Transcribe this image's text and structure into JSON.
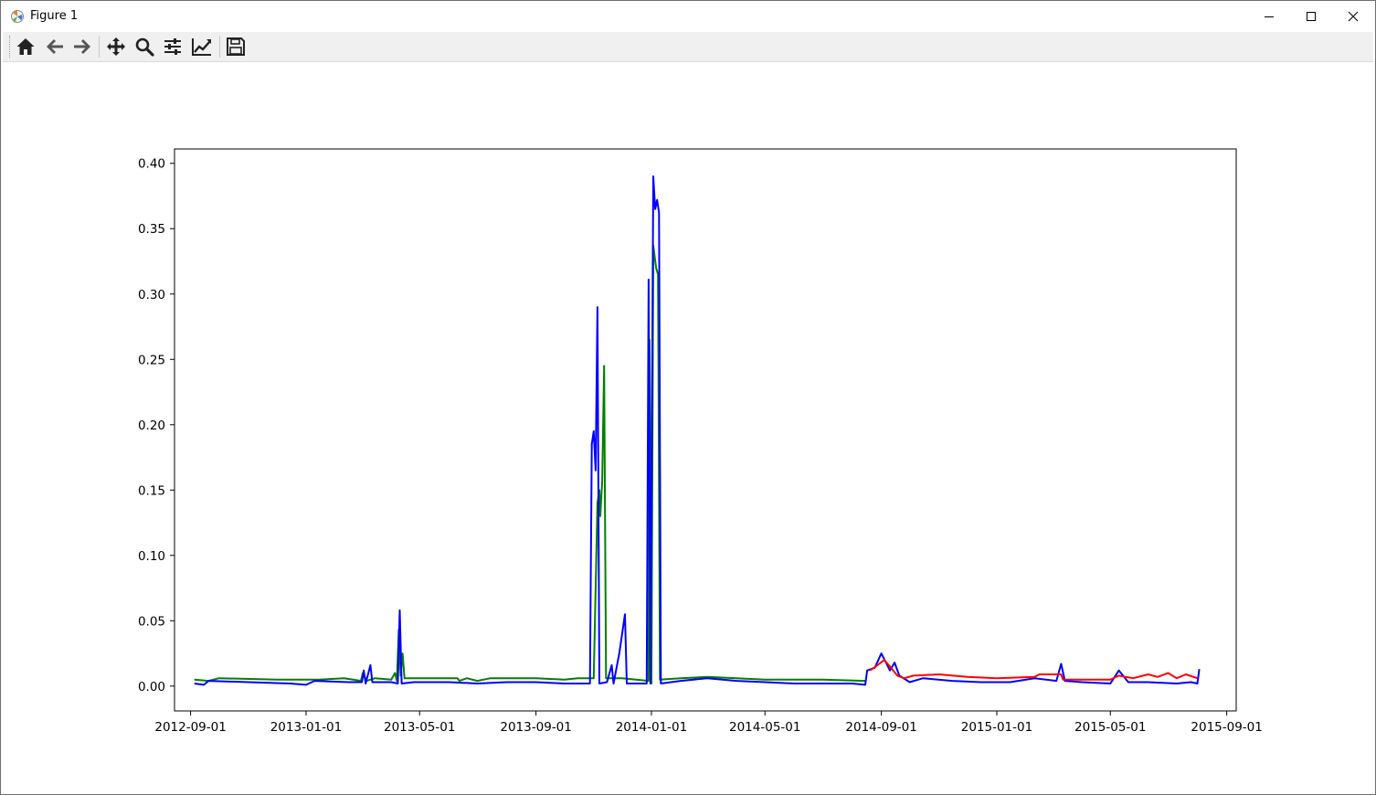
{
  "window": {
    "title": "Figure 1",
    "icon": "matplotlib-icon",
    "controls": [
      "minimize-icon",
      "maximize-icon",
      "close-icon"
    ]
  },
  "toolbar": {
    "buttons": [
      "home-icon",
      "back-icon",
      "forward-icon",
      "pan-icon",
      "zoom-icon",
      "configure-subplots-icon",
      "edit-axis-icon",
      "save-icon"
    ]
  },
  "chart_data": {
    "type": "line",
    "title": "",
    "xlabel": "",
    "ylabel": "",
    "xlim": [
      "2012-08-15",
      "2015-09-11"
    ],
    "ylim": [
      -0.019,
      0.411
    ],
    "xticks": [
      "2012-09-01",
      "2013-01-01",
      "2013-05-01",
      "2013-09-01",
      "2014-01-01",
      "2014-05-01",
      "2014-09-01",
      "2015-01-01",
      "2015-05-01",
      "2015-09-01"
    ],
    "yticks": [
      "0.00",
      "0.05",
      "0.10",
      "0.15",
      "0.20",
      "0.25",
      "0.30",
      "0.35",
      "0.40"
    ],
    "grid": false,
    "legend": "none",
    "series": [
      {
        "color": "#008000",
        "points": [
          [
            "2012-09-05",
            0.005
          ],
          [
            "2012-09-20",
            0.004
          ],
          [
            "2012-10-01",
            0.006
          ],
          [
            "2012-12-01",
            0.005
          ],
          [
            "2013-01-15",
            0.005
          ],
          [
            "2013-02-10",
            0.006
          ],
          [
            "2013-02-28",
            0.004
          ],
          [
            "2013-03-02",
            0.01
          ],
          [
            "2013-03-06",
            0.004
          ],
          [
            "2013-03-15",
            0.006
          ],
          [
            "2013-04-01",
            0.005
          ],
          [
            "2013-04-05",
            0.01
          ],
          [
            "2013-04-07",
            0.004
          ],
          [
            "2013-04-09",
            0.043
          ],
          [
            "2013-04-11",
            0.008
          ],
          [
            "2013-04-13",
            0.025
          ],
          [
            "2013-04-15",
            0.006
          ],
          [
            "2013-05-10",
            0.006
          ],
          [
            "2013-06-10",
            0.006
          ],
          [
            "2013-06-12",
            0.004
          ],
          [
            "2013-06-20",
            0.006
          ],
          [
            "2013-07-01",
            0.004
          ],
          [
            "2013-07-15",
            0.006
          ],
          [
            "2013-09-01",
            0.006
          ],
          [
            "2013-10-01",
            0.005
          ],
          [
            "2013-10-15",
            0.006
          ],
          [
            "2013-11-01",
            0.006
          ],
          [
            "2013-11-05",
            0.14
          ],
          [
            "2013-11-07",
            0.15
          ],
          [
            "2013-11-08",
            0.13
          ],
          [
            "2013-11-10",
            0.157
          ],
          [
            "2013-11-12",
            0.245
          ],
          [
            "2013-11-14",
            0.006
          ],
          [
            "2013-12-01",
            0.006
          ],
          [
            "2013-12-29",
            0.004
          ],
          [
            "2013-12-30",
            0.265
          ],
          [
            "2014-01-01",
            0.002
          ],
          [
            "2014-01-03",
            0.337
          ],
          [
            "2014-01-06",
            0.32
          ],
          [
            "2014-01-08",
            0.315
          ],
          [
            "2014-01-10",
            0.005
          ],
          [
            "2014-02-01",
            0.006
          ],
          [
            "2014-03-01",
            0.007
          ],
          [
            "2014-04-01",
            0.006
          ],
          [
            "2014-05-01",
            0.005
          ],
          [
            "2014-06-01",
            0.005
          ],
          [
            "2014-07-01",
            0.005
          ],
          [
            "2014-08-15",
            0.004
          ]
        ]
      },
      {
        "color": "#0000ff",
        "points": [
          [
            "2012-09-05",
            0.002
          ],
          [
            "2012-09-15",
            0.001
          ],
          [
            "2012-09-20",
            0.004
          ],
          [
            "2012-11-01",
            0.003
          ],
          [
            "2012-12-15",
            0.002
          ],
          [
            "2013-01-01",
            0.001
          ],
          [
            "2013-01-10",
            0.004
          ],
          [
            "2013-02-15",
            0.003
          ],
          [
            "2013-03-01",
            0.003
          ],
          [
            "2013-03-03",
            0.012
          ],
          [
            "2013-03-05",
            0.002
          ],
          [
            "2013-03-10",
            0.016
          ],
          [
            "2013-03-12",
            0.003
          ],
          [
            "2013-04-01",
            0.003
          ],
          [
            "2013-04-08",
            0.002
          ],
          [
            "2013-04-10",
            0.058
          ],
          [
            "2013-04-12",
            0.002
          ],
          [
            "2013-04-25",
            0.003
          ],
          [
            "2013-06-01",
            0.003
          ],
          [
            "2013-07-01",
            0.002
          ],
          [
            "2013-08-01",
            0.003
          ],
          [
            "2013-09-01",
            0.003
          ],
          [
            "2013-10-01",
            0.002
          ],
          [
            "2013-10-20",
            0.002
          ],
          [
            "2013-10-28",
            0.002
          ],
          [
            "2013-10-30",
            0.185
          ],
          [
            "2013-11-01",
            0.195
          ],
          [
            "2013-11-03",
            0.165
          ],
          [
            "2013-11-05",
            0.29
          ],
          [
            "2013-11-07",
            0.002
          ],
          [
            "2013-11-15",
            0.003
          ],
          [
            "2013-11-20",
            0.016
          ],
          [
            "2013-11-22",
            0.002
          ],
          [
            "2013-11-28",
            0.025
          ],
          [
            "2013-12-04",
            0.055
          ],
          [
            "2013-12-06",
            0.002
          ],
          [
            "2013-12-27",
            0.002
          ],
          [
            "2013-12-29",
            0.311
          ],
          [
            "2013-12-31",
            0.002
          ],
          [
            "2014-01-03",
            0.39
          ],
          [
            "2014-01-05",
            0.365
          ],
          [
            "2014-01-07",
            0.372
          ],
          [
            "2014-01-09",
            0.362
          ],
          [
            "2014-01-11",
            0.002
          ],
          [
            "2014-02-01",
            0.004
          ],
          [
            "2014-03-01",
            0.006
          ],
          [
            "2014-04-01",
            0.004
          ],
          [
            "2014-05-01",
            0.003
          ],
          [
            "2014-06-01",
            0.002
          ],
          [
            "2014-08-01",
            0.002
          ],
          [
            "2014-08-15",
            0.001
          ],
          [
            "2014-08-17",
            0.012
          ],
          [
            "2014-08-25",
            0.014
          ],
          [
            "2014-09-01",
            0.025
          ],
          [
            "2014-09-10",
            0.012
          ],
          [
            "2014-09-15",
            0.018
          ],
          [
            "2014-09-20",
            0.008
          ],
          [
            "2014-10-01",
            0.003
          ],
          [
            "2014-10-15",
            0.006
          ],
          [
            "2014-11-15",
            0.004
          ],
          [
            "2014-12-15",
            0.003
          ],
          [
            "2015-01-15",
            0.003
          ],
          [
            "2015-02-10",
            0.006
          ],
          [
            "2015-03-05",
            0.004
          ],
          [
            "2015-03-10",
            0.017
          ],
          [
            "2015-03-14",
            0.004
          ],
          [
            "2015-04-01",
            0.003
          ],
          [
            "2015-05-01",
            0.002
          ],
          [
            "2015-05-10",
            0.012
          ],
          [
            "2015-05-20",
            0.003
          ],
          [
            "2015-06-10",
            0.003
          ],
          [
            "2015-07-10",
            0.002
          ],
          [
            "2015-07-25",
            0.003
          ],
          [
            "2015-08-01",
            0.002
          ],
          [
            "2015-08-03",
            0.013
          ]
        ]
      },
      {
        "color": "#ff0000",
        "points": [
          [
            "2014-08-20",
            0.012
          ],
          [
            "2014-08-28",
            0.016
          ],
          [
            "2014-09-04",
            0.02
          ],
          [
            "2014-09-10",
            0.015
          ],
          [
            "2014-09-18",
            0.008
          ],
          [
            "2014-09-25",
            0.006
          ],
          [
            "2014-10-05",
            0.008
          ],
          [
            "2014-11-01",
            0.009
          ],
          [
            "2014-12-01",
            0.007
          ],
          [
            "2015-01-01",
            0.006
          ],
          [
            "2015-02-10",
            0.007
          ],
          [
            "2015-02-15",
            0.009
          ],
          [
            "2015-03-10",
            0.009
          ],
          [
            "2015-03-12",
            0.005
          ],
          [
            "2015-05-01",
            0.005
          ],
          [
            "2015-05-10",
            0.008
          ],
          [
            "2015-05-25",
            0.006
          ],
          [
            "2015-06-10",
            0.009
          ],
          [
            "2015-06-20",
            0.007
          ],
          [
            "2015-07-01",
            0.01
          ],
          [
            "2015-07-10",
            0.006
          ],
          [
            "2015-07-20",
            0.009
          ],
          [
            "2015-08-01",
            0.006
          ]
        ]
      }
    ]
  }
}
